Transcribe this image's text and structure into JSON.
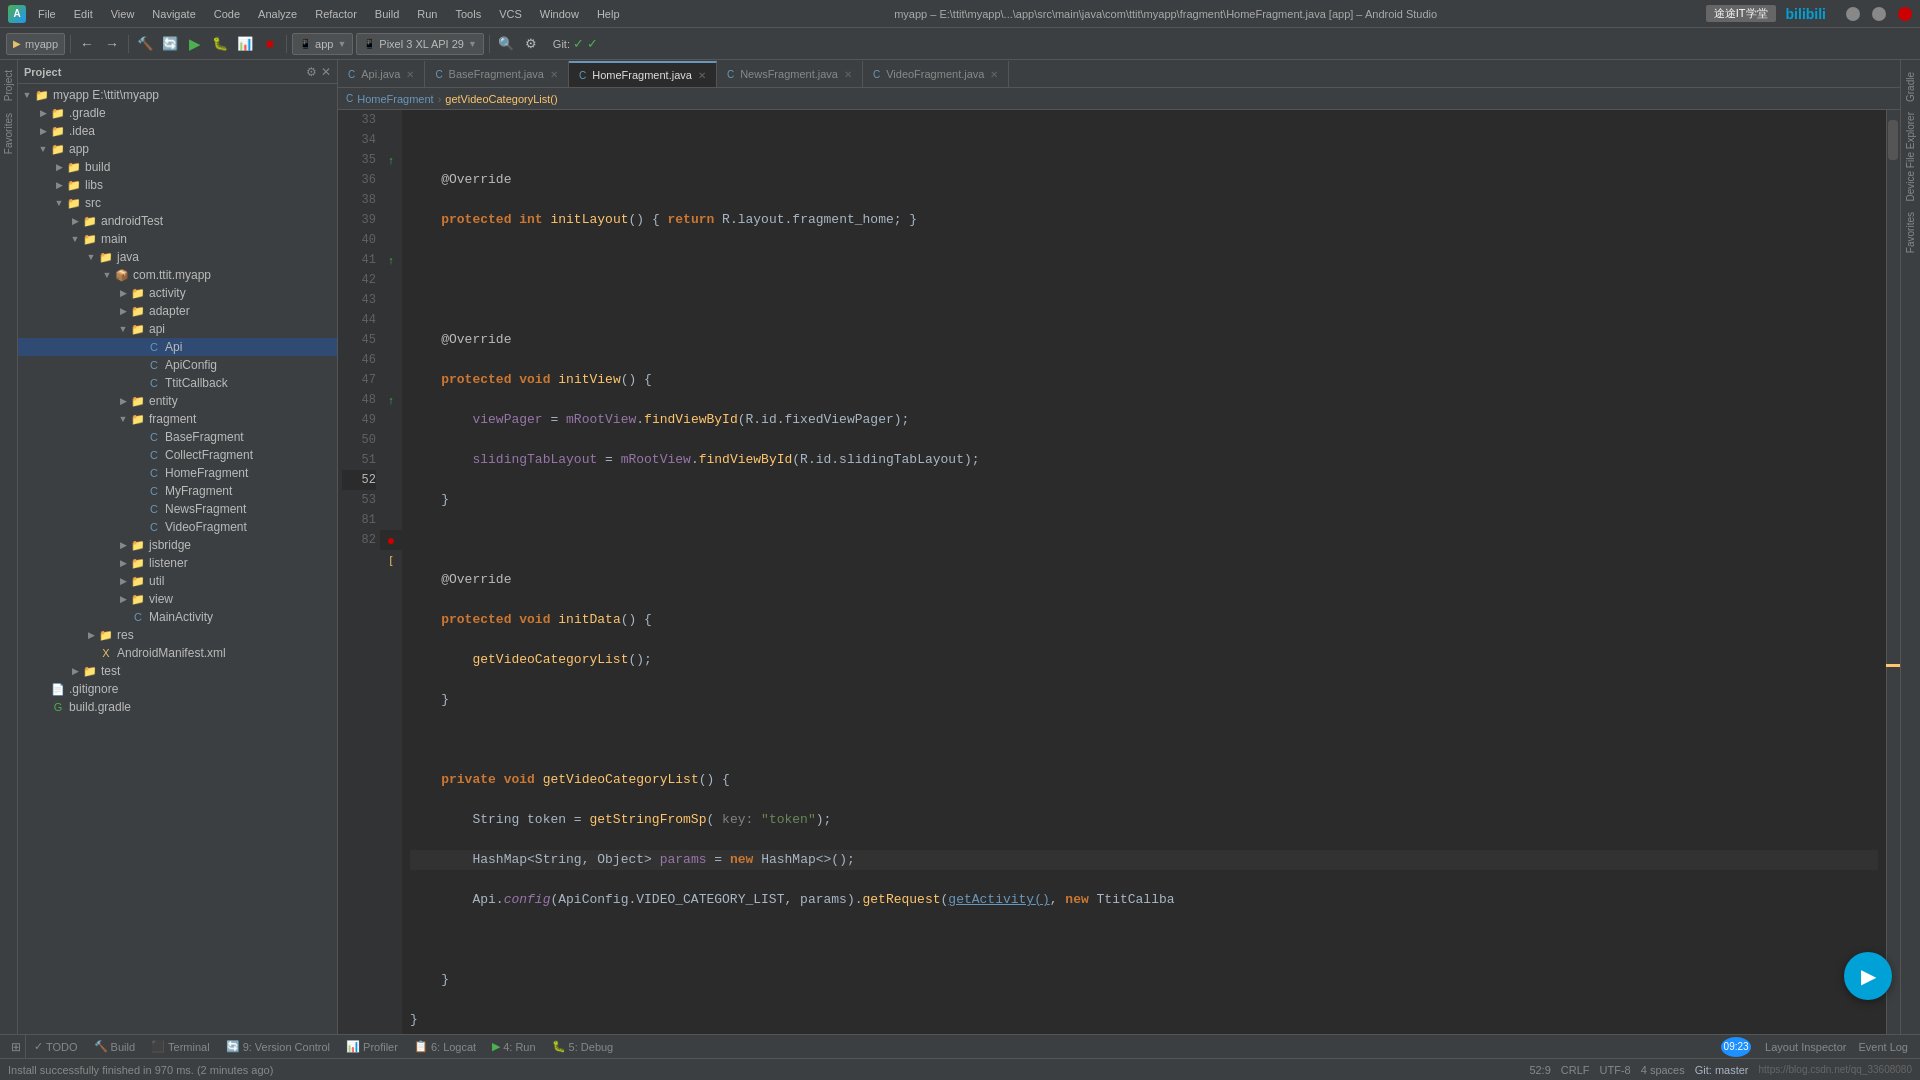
{
  "titlebar": {
    "title": "myapp – E:\\ttit\\myapp\\...\\app\\src\\main\\java\\com\\ttit\\myapp\\fragment\\HomeFragment.java [app] – Android Studio",
    "menu_items": [
      "File",
      "Edit",
      "View",
      "Navigate",
      "Code",
      "Analyze",
      "Refactor",
      "Build",
      "Run",
      "Tools",
      "VCS",
      "Window",
      "Help"
    ]
  },
  "breadcrumb": {
    "items": [
      "myapp",
      "app",
      "src",
      "main",
      "java",
      "com",
      "ttit",
      "myapp",
      "fragment",
      "HomeFragment"
    ]
  },
  "toolbar": {
    "project_label": "myapp",
    "device_label": "Pixel 3 XL API 29",
    "app_label": "app"
  },
  "sidebar": {
    "title": "Project",
    "tree": [
      {
        "id": "myapp",
        "label": "myapp E:\\ttit\\myapp",
        "level": 0,
        "type": "project",
        "expanded": true
      },
      {
        "id": "gradle",
        "label": ".gradle",
        "level": 1,
        "type": "folder",
        "expanded": false
      },
      {
        "id": "idea",
        "label": ".idea",
        "level": 1,
        "type": "folder",
        "expanded": false
      },
      {
        "id": "app",
        "label": "app",
        "level": 1,
        "type": "folder",
        "expanded": true
      },
      {
        "id": "build_app",
        "label": "build",
        "level": 2,
        "type": "folder",
        "expanded": false
      },
      {
        "id": "libs",
        "label": "libs",
        "level": 2,
        "type": "folder",
        "expanded": false
      },
      {
        "id": "src",
        "label": "src",
        "level": 2,
        "type": "folder",
        "expanded": true
      },
      {
        "id": "androidTest",
        "label": "androidTest",
        "level": 3,
        "type": "folder",
        "expanded": false
      },
      {
        "id": "main",
        "label": "main",
        "level": 3,
        "type": "folder",
        "expanded": true
      },
      {
        "id": "java",
        "label": "java",
        "level": 4,
        "type": "folder",
        "expanded": true
      },
      {
        "id": "com_ttit",
        "label": "com.ttit.myapp",
        "level": 5,
        "type": "package",
        "expanded": true
      },
      {
        "id": "activity",
        "label": "activity",
        "level": 6,
        "type": "folder",
        "expanded": false
      },
      {
        "id": "adapter",
        "label": "adapter",
        "level": 6,
        "type": "folder",
        "expanded": false
      },
      {
        "id": "api",
        "label": "api",
        "level": 6,
        "type": "folder",
        "expanded": true
      },
      {
        "id": "Api",
        "label": "Api",
        "level": 7,
        "type": "java",
        "expanded": false,
        "selected": true
      },
      {
        "id": "ApiConfig",
        "label": "ApiConfig",
        "level": 7,
        "type": "java"
      },
      {
        "id": "TtitCallback",
        "label": "TtitCallback",
        "level": 7,
        "type": "java"
      },
      {
        "id": "entity",
        "label": "entity",
        "level": 6,
        "type": "folder",
        "expanded": false
      },
      {
        "id": "fragment",
        "label": "fragment",
        "level": 6,
        "type": "folder",
        "expanded": true
      },
      {
        "id": "BaseFragment",
        "label": "BaseFragment",
        "level": 7,
        "type": "java"
      },
      {
        "id": "CollectFragment",
        "label": "CollectFragment",
        "level": 7,
        "type": "java"
      },
      {
        "id": "HomeFragment",
        "label": "HomeFragment",
        "level": 7,
        "type": "java"
      },
      {
        "id": "MyFragment",
        "label": "MyFragment",
        "level": 7,
        "type": "java"
      },
      {
        "id": "NewsFragment",
        "label": "NewsFragment",
        "level": 7,
        "type": "java"
      },
      {
        "id": "VideoFragment",
        "label": "VideoFragment",
        "level": 7,
        "type": "java"
      },
      {
        "id": "jsbridge",
        "label": "jsbridge",
        "level": 6,
        "type": "folder",
        "expanded": false
      },
      {
        "id": "listener",
        "label": "listener",
        "level": 6,
        "type": "folder",
        "expanded": false
      },
      {
        "id": "util",
        "label": "util",
        "level": 6,
        "type": "folder",
        "expanded": false
      },
      {
        "id": "view",
        "label": "view",
        "level": 6,
        "type": "folder",
        "expanded": false
      },
      {
        "id": "MainActivity",
        "label": "MainActivity",
        "level": 6,
        "type": "java"
      },
      {
        "id": "res",
        "label": "res",
        "level": 4,
        "type": "folder",
        "expanded": false
      },
      {
        "id": "AndroidManifest",
        "label": "AndroidManifest.xml",
        "level": 4,
        "type": "xml"
      },
      {
        "id": "test",
        "label": "test",
        "level": 3,
        "type": "folder",
        "expanded": false
      },
      {
        "id": "gitignore",
        "label": ".gitignore",
        "level": 1,
        "type": "file"
      },
      {
        "id": "build_gradle",
        "label": "build.gradle",
        "level": 1,
        "type": "gradle"
      }
    ]
  },
  "tabs": [
    {
      "id": "api",
      "label": "Api.java",
      "active": false,
      "modified": false
    },
    {
      "id": "base",
      "label": "BaseFragment.java",
      "active": false,
      "modified": false
    },
    {
      "id": "home",
      "label": "HomeFragment.java",
      "active": true,
      "modified": false
    },
    {
      "id": "news",
      "label": "NewsFragment.java",
      "active": false,
      "modified": false
    },
    {
      "id": "video",
      "label": "VideoFragment.java",
      "active": false,
      "modified": false
    }
  ],
  "editor_breadcrumb": {
    "items": [
      "HomeFragment",
      "getVideoCategory​List()"
    ]
  },
  "code_lines": [
    {
      "num": 33,
      "content": ""
    },
    {
      "num": 34,
      "content": "    @Override",
      "type": "annotation"
    },
    {
      "num": 35,
      "content": "    protected int initLayout() { return R.layout.fragment_home; }",
      "has_override": true
    },
    {
      "num": 36,
      "content": ""
    },
    {
      "num": 38,
      "content": ""
    },
    {
      "num": 39,
      "content": "    @Override",
      "type": "annotation"
    },
    {
      "num": 40,
      "content": "    protected void initView() {",
      "has_override": true
    },
    {
      "num": 41,
      "content": "        viewPager = mRootView.findViewById(R.id.fixedViewPager);"
    },
    {
      "num": 42,
      "content": "        slidingTabLayout = mRootView.findViewById(R.id.slidingTabLayout);"
    },
    {
      "num": 43,
      "content": "    }"
    },
    {
      "num": 44,
      "content": ""
    },
    {
      "num": 45,
      "content": "    @Override",
      "type": "annotation"
    },
    {
      "num": 46,
      "content": "    protected void initData() {",
      "has_override": true
    },
    {
      "num": 47,
      "content": "        getVideoCategory​List();"
    },
    {
      "num": 48,
      "content": "    }"
    },
    {
      "num": 49,
      "content": ""
    },
    {
      "num": 50,
      "content": "    private void getVideoCategory​List() {"
    },
    {
      "num": 51,
      "content": "        String token = getStringFromSp( key: \"token\");"
    },
    {
      "num": 52,
      "content": "        HashMap<String, Object> params = new HashMap<>();",
      "highlight": true
    },
    {
      "num": 53,
      "content": "        Api.config(ApiConfig.VIDEO_CATEGORY_LIST, params).getRequest(getActivity(), new TtitCallba"
    },
    {
      "num": 81,
      "content": "    }"
    },
    {
      "num": 82,
      "content": "}"
    }
  ],
  "status_bar": {
    "message": "Install successfully finished in 970 ms. (2 minutes ago)",
    "position": "52:9",
    "encoding": "CRLF",
    "charset": "UTF-8",
    "indent": "4 spaces",
    "git": "Git: master"
  },
  "bottom_tabs": [
    {
      "label": "TODO",
      "icon": "✓"
    },
    {
      "label": "Build",
      "icon": "🔨"
    },
    {
      "label": "Terminal",
      "icon": "⬛"
    },
    {
      "label": "Version Control",
      "icon": "🔄",
      "num": "9"
    },
    {
      "label": "Profiler",
      "icon": "📊"
    },
    {
      "label": "Logcat",
      "icon": "📋",
      "num": "6"
    },
    {
      "label": "Run",
      "icon": "▶",
      "num": "4"
    },
    {
      "label": "Debug",
      "icon": "🐛",
      "num": "5"
    }
  ],
  "time_badge": "09:23",
  "layout_inspector": "Layout Inspector",
  "event_log": "Event Log",
  "watermark1": "途途IT学堂",
  "watermark2": "bilibili"
}
